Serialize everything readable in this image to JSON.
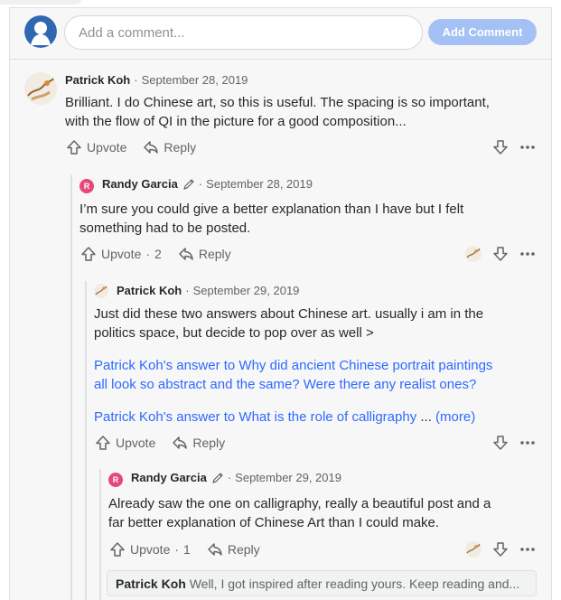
{
  "composer": {
    "placeholder": "Add a comment...",
    "button_label": "Add Comment"
  },
  "comments": [
    {
      "author": "Patrick Koh",
      "date": "September 28, 2019",
      "body": [
        "Brilliant. I do Chinese art, so this is useful. The spacing is so important,",
        "with the flow of QI in the picture for a good composition..."
      ],
      "upvote_label": "Upvote",
      "reply_label": "Reply"
    },
    {
      "author": "Randy Garcia",
      "avatar_letter": "R",
      "date": "September 28, 2019",
      "body": [
        "I’m sure you could give a better explanation than I have but I felt",
        "something had to be posted."
      ],
      "upvote_label": "Upvote",
      "upvote_count": "2",
      "reply_label": "Reply"
    },
    {
      "author": "Patrick Koh",
      "date": "September 29, 2019",
      "body": [
        "Just did these two answers about Chinese art. usually i am in the",
        "politics space, but decide to pop over as well >"
      ],
      "link1": [
        "Patrick Koh's answer to Why did ancient Chinese portrait paintings",
        "all look so abstract and the same? Were there any realist ones?"
      ],
      "link2": "Patrick Koh's answer to What is the role of calligraphy",
      "ellipsis": "...",
      "more": "(more)",
      "upvote_label": "Upvote",
      "reply_label": "Reply"
    },
    {
      "author": "Randy Garcia",
      "avatar_letter": "R",
      "date": "September 29, 2019",
      "body": [
        "Already saw the one on calligraphy, really a beautiful post and a",
        "far better explanation of Chinese Art than I could make."
      ],
      "upvote_label": "Upvote",
      "upvote_count": "1",
      "reply_label": "Reply"
    }
  ],
  "preview": {
    "author": "Patrick Koh",
    "text": "Well, I got inspired after reading yours. Keep reading and..."
  },
  "separator": "·",
  "colors": {
    "accent": "#2e69ff",
    "button": "#a3c1f5",
    "avatar_r": "#e5497a"
  }
}
